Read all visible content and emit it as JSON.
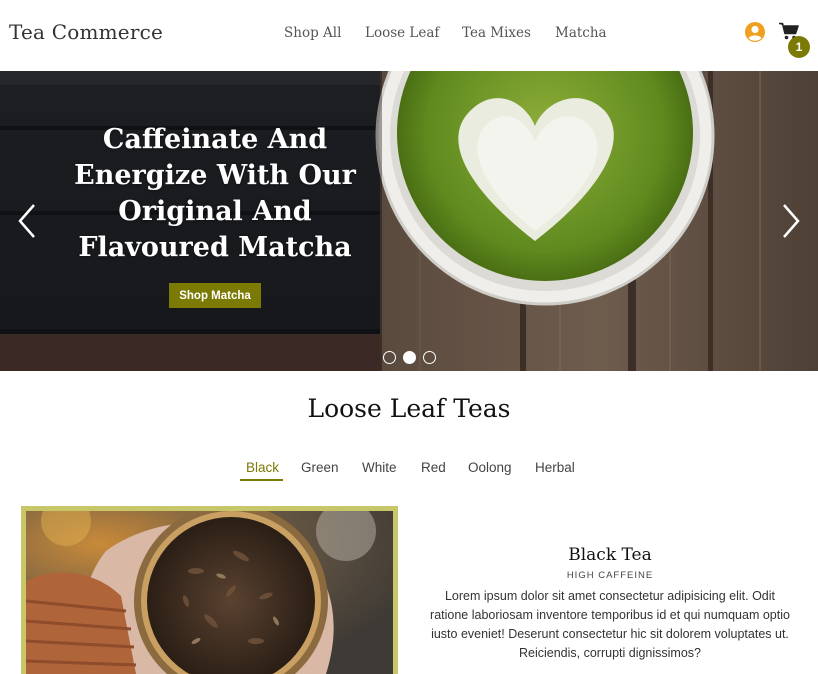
{
  "header": {
    "brand": "Tea Commerce",
    "nav": [
      "Shop All",
      "Loose Leaf",
      "Tea Mixes",
      "Matcha"
    ],
    "cart_count": "1",
    "icons": {
      "account": "user-circle-icon",
      "cart": "shopping-cart-icon"
    }
  },
  "hero": {
    "title": "Caffeinate And Energize With Our Original And Flavoured Matcha",
    "button_label": "Shop Matcha",
    "slides_total": 3,
    "active_slide": 2
  },
  "section": {
    "title": "Loose Leaf Teas",
    "tabs": [
      "Black",
      "Green",
      "White",
      "Red",
      "Oolong",
      "Herbal"
    ],
    "active_tab": "Black"
  },
  "product": {
    "name": "Black Tea",
    "tag": "HIGH CAFFEINE",
    "description": "Lorem ipsum dolor sit amet consectetur adipisicing elit. Odit ratione laboriosam inventore temporibus id et qui numquam optio iusto eveniet! Deserunt consectetur hic sit dolorem voluptates ut. Reiciendis, corrupti dignissimos?"
  },
  "colors": {
    "accent": "#7a7a05",
    "account_icon": "#f0a020",
    "frame": "#c7c76a"
  }
}
